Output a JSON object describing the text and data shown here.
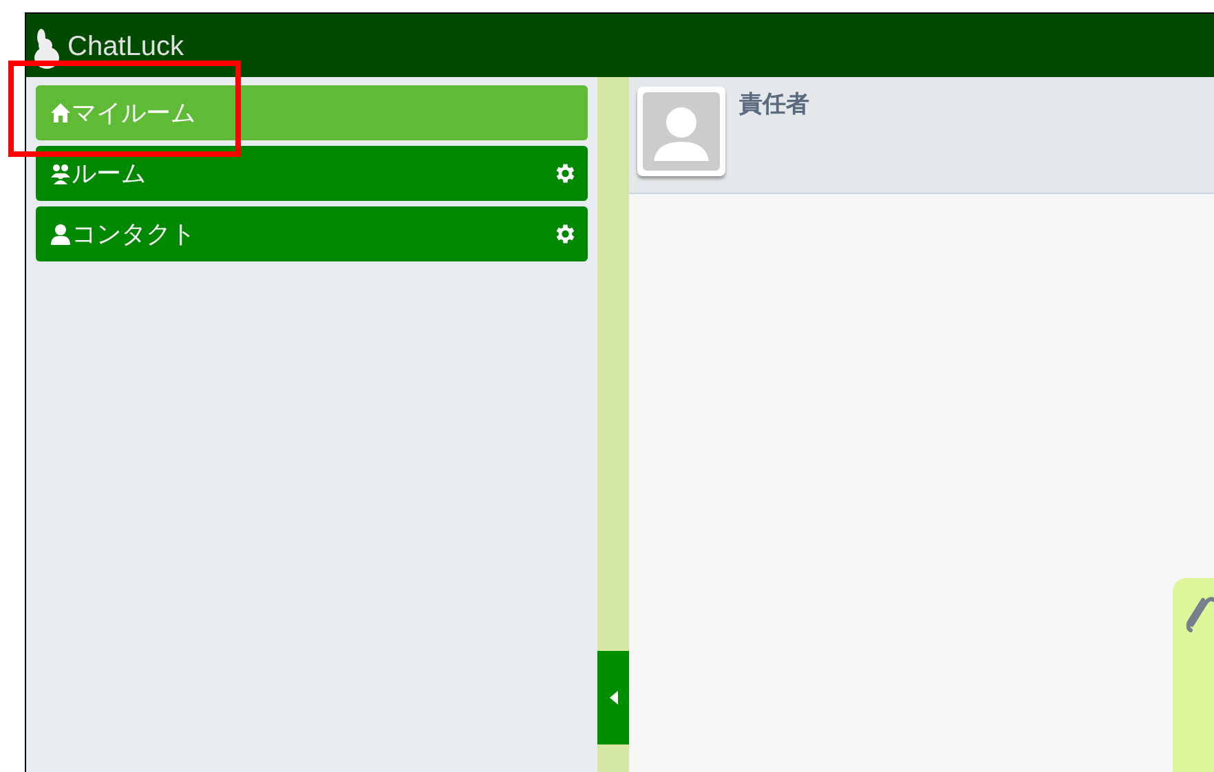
{
  "app": {
    "logo": "ChatLuck"
  },
  "sidebar": {
    "items": [
      {
        "label": "マイルーム",
        "kind": "home",
        "selected": true,
        "settings": false
      },
      {
        "label": "ルーム",
        "kind": "room",
        "selected": false,
        "settings": true
      },
      {
        "label": "コンタクト",
        "kind": "contact",
        "selected": false,
        "settings": true
      }
    ]
  },
  "room_header": {
    "name": "責任者"
  }
}
